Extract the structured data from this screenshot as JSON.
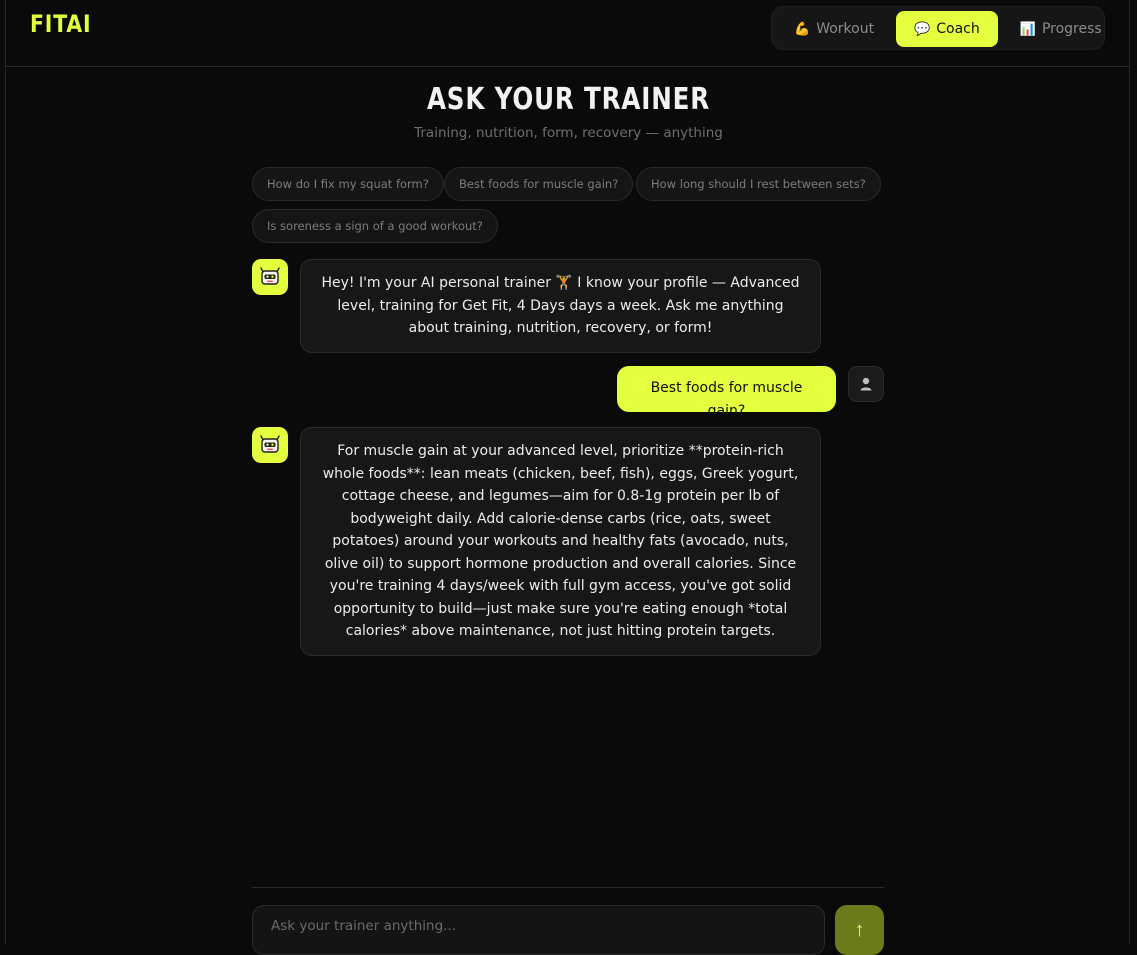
{
  "app": {
    "logo": "FITAI"
  },
  "nav": {
    "tabs": [
      {
        "icon": "💪",
        "label": "Workout",
        "active": false
      },
      {
        "icon": "💬",
        "label": "Coach",
        "active": true
      },
      {
        "icon": "📊",
        "label": "Progress",
        "active": false
      }
    ]
  },
  "page": {
    "title": "ASK YOUR TRAINER",
    "subtitle": "Training, nutrition, form, recovery — anything"
  },
  "suggestions": [
    "How do I fix my squat form?",
    "Best foods for muscle gain?",
    "How long should I rest between sets?",
    "Is soreness a sign of a good workout?"
  ],
  "messages": [
    {
      "role": "assistant",
      "text": "Hey! I'm your AI personal trainer 🏋️ I know your profile — Advanced level, training for Get Fit, 4 Days days a week. Ask me anything about training, nutrition, recovery, or form!"
    },
    {
      "role": "user",
      "text": "Best foods for muscle gain?"
    },
    {
      "role": "assistant",
      "text": "For muscle gain at your advanced level, prioritize **protein-rich whole foods**: lean meats (chicken, beef, fish), eggs, Greek yogurt, cottage cheese, and legumes—aim for 0.8-1g protein per lb of bodyweight daily. Add calorie-dense carbs (rice, oats, sweet potatoes) around your workouts and healthy fats (avocado, nuts, olive oil) to support hormone production and overall calories. Since you're training 4 days/week with full gym access, you've got solid opportunity to build—just make sure you're eating enough *total calories* above maintenance, not just hitting protein targets."
    }
  ],
  "composer": {
    "placeholder": "Ask your trainer anything...",
    "value": "",
    "send_icon": "↑"
  },
  "colors": {
    "accent": "#e3ff3d",
    "background": "#0a0a0a",
    "bubble": "#171717",
    "send_disabled": "#6b7a1a"
  }
}
